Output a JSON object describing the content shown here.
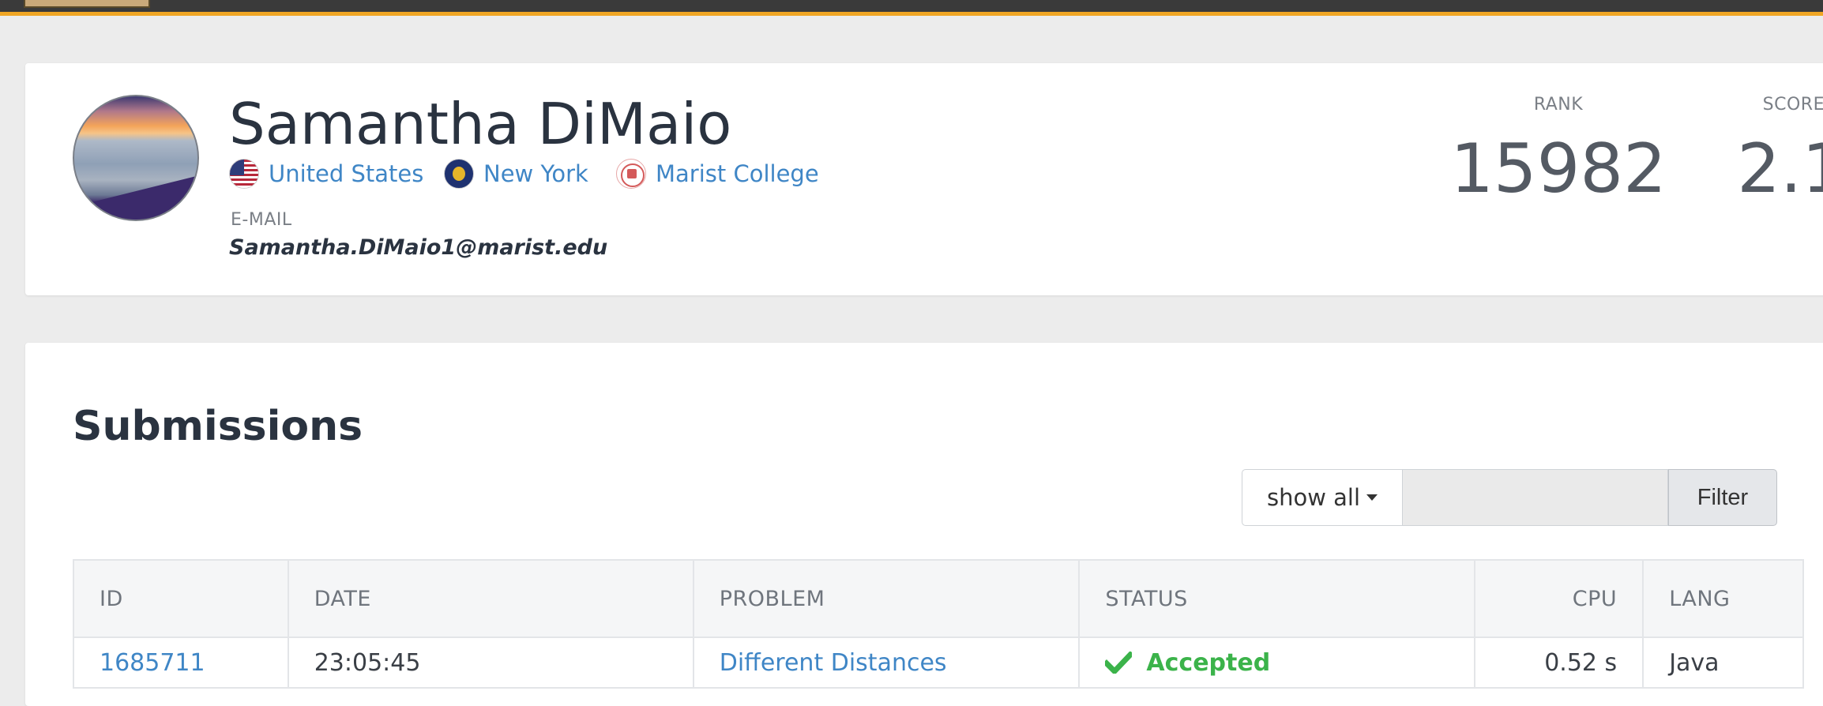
{
  "profile": {
    "name": "Samantha DiMaio",
    "country": "United States",
    "subdivision": "New York",
    "school": "Marist College",
    "email_label": "E-MAIL",
    "email": "Samantha.DiMaio1@marist.edu",
    "rank_label": "RANK",
    "rank": "15982",
    "score_label": "SCORE",
    "score": "2.1"
  },
  "submissions": {
    "title": "Submissions",
    "filter_dropdown": "show all",
    "filter_input_value": "",
    "filter_button": "Filter",
    "columns": [
      "ID",
      "DATE",
      "PROBLEM",
      "STATUS",
      "CPU",
      "LANG"
    ],
    "rows": [
      {
        "id": "1685711",
        "date": "23:05:45",
        "problem": "Different Distances",
        "status": "Accepted",
        "cpu": "0.52 s",
        "lang": "Java"
      }
    ]
  },
  "colors": {
    "accent_bar": "#f0a624",
    "link": "#3f86c6",
    "accepted": "#3bb34a"
  },
  "icons": [
    "avatar",
    "us-flag-icon",
    "new-york-flag-icon",
    "marist-college-logo-icon",
    "caret-down-icon",
    "check-icon"
  ]
}
